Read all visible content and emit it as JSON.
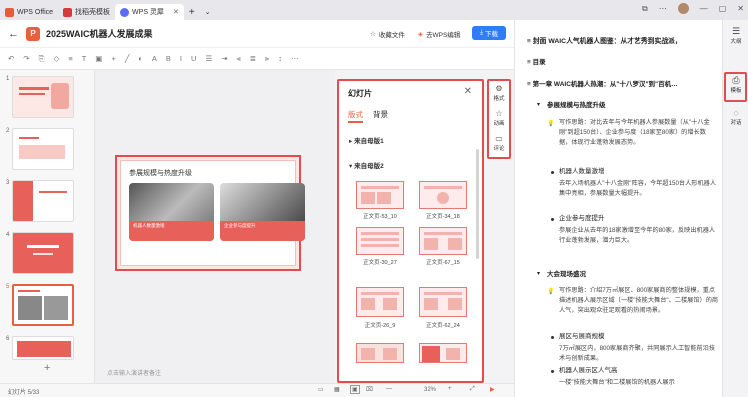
{
  "tabs": [
    {
      "label": "WPS Office",
      "color": "#e85c3c"
    },
    {
      "label": "找稻壳模板",
      "color": "#d63a3a"
    },
    {
      "label": "WPS 灵犀",
      "color": "#5b6cf0"
    }
  ],
  "header": {
    "doc_title": "2025WAIC机器人发展成果",
    "collect": "收藏文件",
    "edit_in_wps": "去WPS编辑",
    "download": "下载"
  },
  "slide": {
    "title": "参展规模与热度升级",
    "cap1": "机器人数量激增",
    "cap2": "企业参与度提升"
  },
  "panel": {
    "title": "幻灯片",
    "tab_layout": "版式",
    "tab_bg": "背景",
    "section1": "来自母版1",
    "section2": "来自母版2",
    "layouts": [
      "正文页-53_10",
      "正文页-34_18",
      "正文页-30_27",
      "正文页-67_15",
      "正文页-26_9",
      "正文页-62_24"
    ]
  },
  "side_tools": [
    "格式",
    "动画",
    "评论"
  ],
  "notes_placeholder": "点击输入演讲者备注",
  "status": {
    "slide_count": "幻灯片 5/33",
    "zoom": "32%"
  },
  "thumb_numbers": [
    "1",
    "2",
    "3",
    "4",
    "5",
    "6"
  ],
  "outline": {
    "items": [
      {
        "text": "封面 WAIC人气机器人图鉴：从才艺秀到实战派，",
        "bold": true
      },
      {
        "text": "目录",
        "bold": true
      },
      {
        "text": "第一章 WAIC机器人热潮：从\"十八罗汉\"到\"百机…",
        "bold": true
      },
      {
        "text": "参展规模与热度升级",
        "bold": true
      },
      {
        "text": "写作思路：对比去年与今年机器人参展数量（从\"十八金刚\"到超150台）、企业参与度（18家至80家）的增长数据，体现行业蓬勃发展态势。"
      },
      {
        "text": "机器人数量激增"
      },
      {
        "text": "去年入场机器人\"十八金刚\"阵容，今年超150台人形机器人集中亮相，参展数量大幅提升。"
      },
      {
        "text": "企业参与度提升"
      },
      {
        "text": "参展企业从去年的18家激增至今年的80家，反映出机器人行业蓬勃发展，潜力巨大。"
      },
      {
        "text": "大会现场盛况",
        "bold": true
      },
      {
        "text": "写作思路：介绍7万㎡展区、800家展商的整体规模，重点描述机器人展示区域（一楼\"技能大舞台\"、二楼展馆）的商人气，突出观众驻足观看的热闹场景。"
      },
      {
        "text": "展区与展商规模"
      },
      {
        "text": "7万㎡展区内，800家展商齐聚，共同展示人工智能前沿技术与创新成果。"
      },
      {
        "text": "机器人展示区人气高"
      },
      {
        "text": "一楼\"技能大舞台\"和二楼展馆的机器人展示"
      }
    ]
  },
  "right_bar": [
    "大纲",
    "模板",
    "对话"
  ]
}
